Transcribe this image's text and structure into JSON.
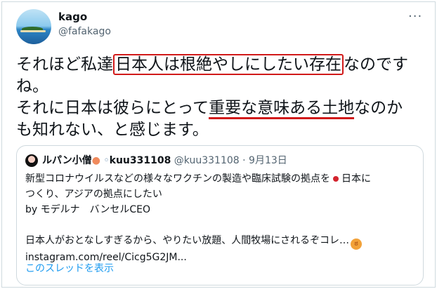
{
  "tweet": {
    "display_name": "kago",
    "handle": "@fafakago",
    "more_icon": "more-horizontal-icon",
    "text_part1": "それほど私達",
    "text_boxed": "日本人は根絶やしにしたい存在",
    "text_part2": "なのです\nね。\nそれに日本は彼らにとって",
    "text_underlined": "重要な意味ある土地",
    "text_part3": "なのか\nも知れない、と感じます。",
    "highlight_color": "#d11a1a"
  },
  "quote": {
    "display_name": "ルパン小僧",
    "emoji_icons": [
      "peach-icon",
      "ring-icon"
    ],
    "username": "kuu331108",
    "handle": "@kuu331108",
    "date": "9月13日",
    "body_line1a": "新型コロナウイルスなどの様々なワクチンの製造や臨床試験の拠点を",
    "body_line1b": "日本に",
    "body_line2": "つくり、アジアの拠点にしたい",
    "body_line3": "by モデルナ　バンセルCEO",
    "body_line4": "日本人がおとなしすぎるから、やりたい放題、人間牧場にされるぞコレ…",
    "body_line5": "instagram.com/reel/Cicg5G2JM...",
    "show_thread": "このスレッドを表示"
  },
  "colors": {
    "link": "#1d9bf0",
    "muted": "#536471",
    "border": "#cfd9de"
  }
}
